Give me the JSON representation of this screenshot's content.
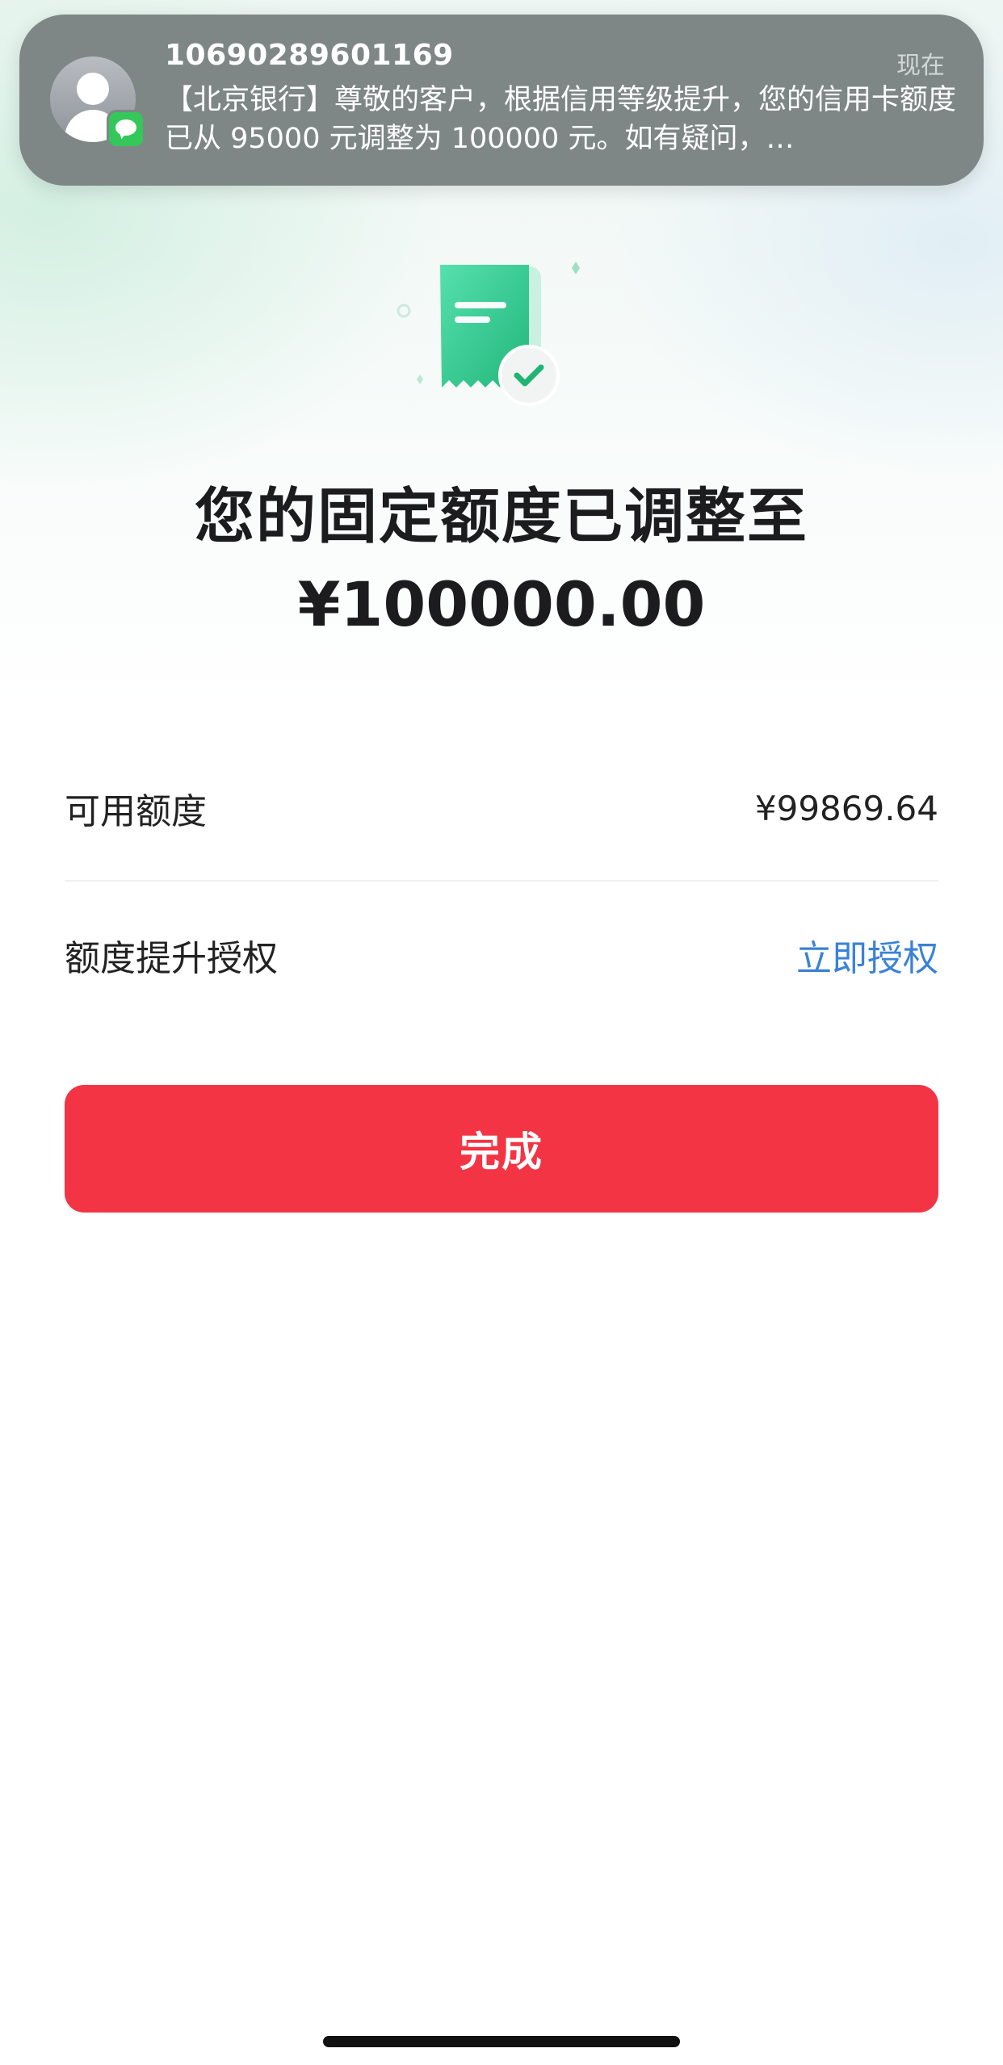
{
  "notification": {
    "sender": "10690289601169",
    "time": "现在",
    "body": "【北京银行】尊敬的客户，根据信用等级提升，您的信用卡额度已从 95000 元调整为 100000 元。如有疑问，…",
    "avatar_icon": "contact-avatar-icon",
    "badge_icon": "messages-app-icon"
  },
  "main": {
    "illustration_icon": "receipt-check-icon",
    "title": "您的固定额度已调整至",
    "amount": "¥100000.00"
  },
  "details": {
    "available_label": "可用额度",
    "available_value": "¥99869.64",
    "authorize_label": "额度提升授权",
    "authorize_link": "立即授权"
  },
  "actions": {
    "done_label": "完成"
  },
  "colors": {
    "accent_red": "#f23444",
    "link_blue": "#3a82d6",
    "illustration_green": "#3fd39a"
  }
}
